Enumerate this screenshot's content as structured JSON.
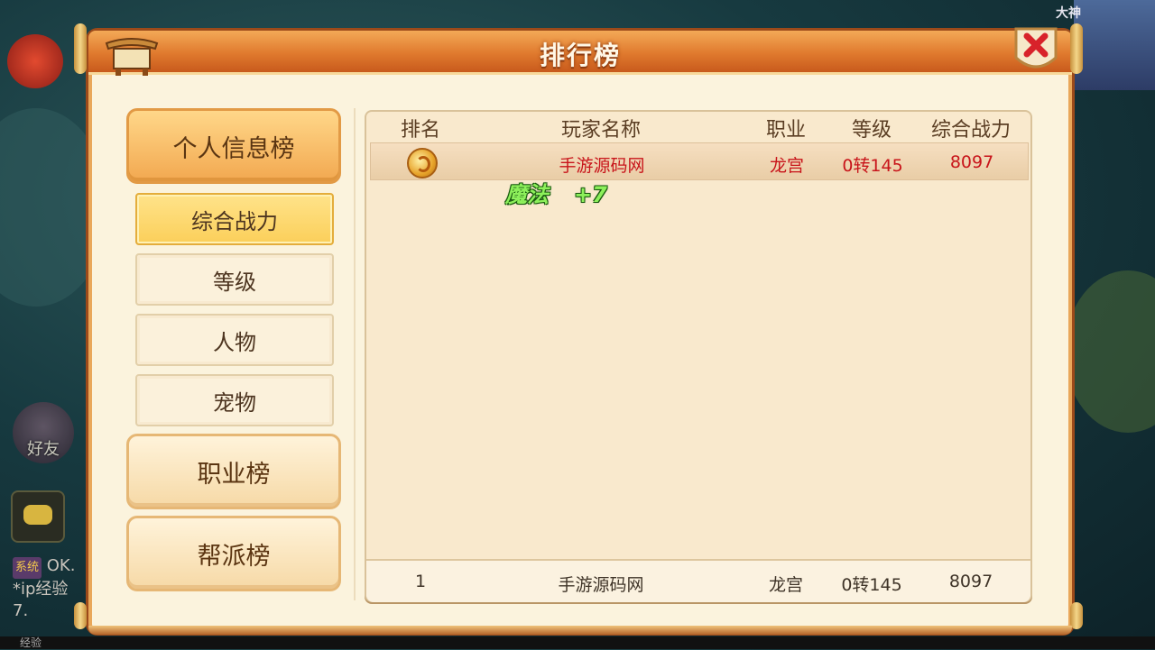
{
  "background": {
    "friend_label": "好友",
    "chat_log": {
      "tag": "系统",
      "line1": "OK.",
      "line2": "*ip经验",
      "line3": "7."
    },
    "exp_label": "经验",
    "top_player_name": "大神"
  },
  "dialog": {
    "title": "排行榜"
  },
  "menu": {
    "categories": [
      {
        "label": "个人信息榜",
        "active": true
      },
      {
        "label": "职业榜",
        "active": false
      },
      {
        "label": "帮派榜",
        "active": false
      }
    ],
    "subitems": [
      {
        "label": "综合战力",
        "active": true
      },
      {
        "label": "等级",
        "active": false
      },
      {
        "label": "人物",
        "active": false
      },
      {
        "label": "宠物",
        "active": false
      }
    ]
  },
  "table": {
    "headers": [
      "排名",
      "玩家名称",
      "职业",
      "等级",
      "综合战力"
    ],
    "rows": [
      {
        "rank_icon": "gold-medal-icon",
        "name": "手游源码网",
        "class": "龙宫",
        "level": "0转145",
        "power": "8097"
      }
    ],
    "float_text": {
      "label": "魔法",
      "value": "+7"
    },
    "my_rank": {
      "rank": "1",
      "name": "手游源码网",
      "class": "龙宫",
      "level": "0转145",
      "power": "8097"
    }
  },
  "colors": {
    "title_bar": "#e07a2e",
    "panel_bg": "#fbf3dd",
    "highlight_text": "#c8141a",
    "active_tab": "#fbcf5a"
  }
}
